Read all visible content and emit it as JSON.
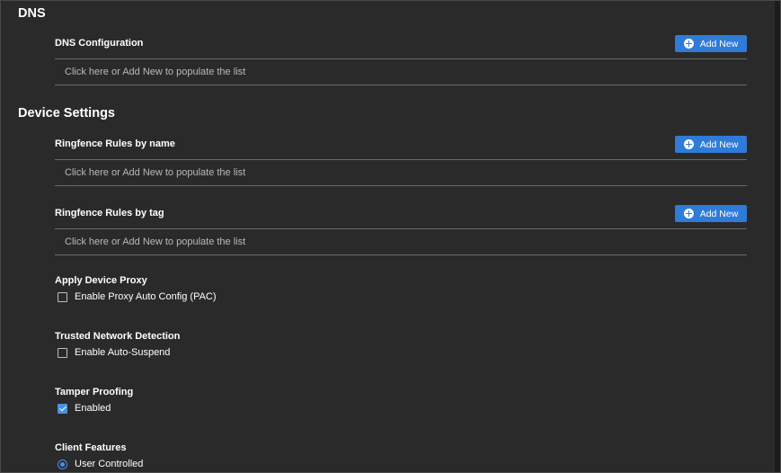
{
  "dns": {
    "title": "DNS",
    "configuration": {
      "label": "DNS Configuration",
      "add_label": "Add New",
      "empty_text": "Click here or Add New to populate the list"
    }
  },
  "device_settings": {
    "title": "Device Settings",
    "ringfence_by_name": {
      "label": "Ringfence Rules by name",
      "add_label": "Add New",
      "empty_text": "Click here or Add New to populate the list"
    },
    "ringfence_by_tag": {
      "label": "Ringfence Rules by tag",
      "add_label": "Add New",
      "empty_text": "Click here or Add New to populate the list"
    },
    "device_proxy": {
      "label": "Apply Device Proxy",
      "option": "Enable Proxy Auto Config (PAC)",
      "checked": false
    },
    "trusted_network": {
      "label": "Trusted Network Detection",
      "option": "Enable Auto-Suspend",
      "checked": false
    },
    "tamper_proofing": {
      "label": "Tamper Proofing",
      "option": "Enabled",
      "checked": true
    },
    "client_features": {
      "label": "Client Features",
      "option": "User Controlled",
      "selected": true
    }
  },
  "colors": {
    "background": "#2a2a2a",
    "accent": "#2f7bd8",
    "check": "#4a90e2",
    "divider": "#6a6a6a",
    "placeholder_text": "#b9b9b9"
  },
  "icons": [
    "plus-circle-icon",
    "checkbox-icon",
    "checkmark-icon",
    "radio-icon"
  ]
}
